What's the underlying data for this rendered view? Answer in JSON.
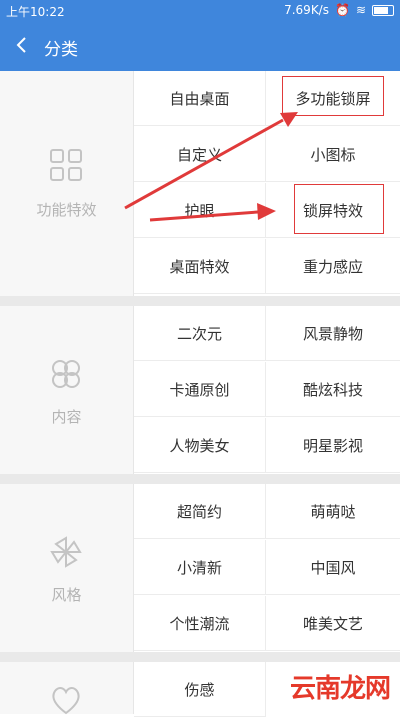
{
  "status": {
    "time": "上午10:22",
    "speed": "7.69K/s"
  },
  "appbar": {
    "title": "分类"
  },
  "categories": [
    {
      "label": "功能特效",
      "items": [
        "自由桌面",
        "多功能锁屏",
        "自定义",
        "小图标",
        "护眼",
        "锁屏特效",
        "桌面特效",
        "重力感应"
      ]
    },
    {
      "label": "内容",
      "items": [
        "二次元",
        "风景静物",
        "卡通原创",
        "酷炫科技",
        "人物美女",
        "明星影视"
      ]
    },
    {
      "label": "风格",
      "items": [
        "超简约",
        "萌萌哒",
        "小清新",
        "中国风",
        "个性潮流",
        "唯美文艺"
      ]
    },
    {
      "label": "",
      "items": [
        "伤感"
      ]
    }
  ],
  "watermark": "云南龙网",
  "colors": {
    "accent": "#3f86dc",
    "annotation": "#e03a3a"
  }
}
